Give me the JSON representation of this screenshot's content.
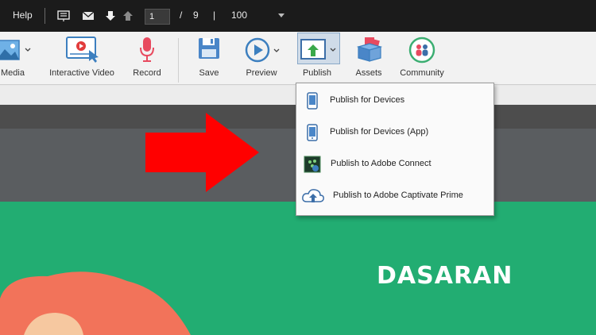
{
  "topbar": {
    "help_label": "Help",
    "current_page": "1",
    "page_separator": "/",
    "total_pages": "9",
    "divider": "|",
    "zoom": "100"
  },
  "ribbon": {
    "media_label": "Media",
    "interactive_video_label": "Interactive Video",
    "record_label": "Record",
    "save_label": "Save",
    "preview_label": "Preview",
    "publish_label": "Publish",
    "assets_label": "Assets",
    "community_label": "Community"
  },
  "publish_menu": {
    "items": [
      {
        "label": "Publish for Devices",
        "icon": "device-icon"
      },
      {
        "label": "Publish for Devices (App)",
        "icon": "device-app-icon"
      },
      {
        "label": "Publish to Adobe Connect",
        "icon": "adobe-connect-icon"
      },
      {
        "label": "Publish to Adobe Captivate Prime",
        "icon": "cloud-upload-icon"
      }
    ]
  },
  "slide": {
    "title": "DASARAN"
  },
  "colors": {
    "topbar": "#1b1b1b",
    "ribbon": "#f2f2f2",
    "slide_green": "#22ad72",
    "arrow_red": "#ff0000",
    "hair": "#f2735a"
  }
}
